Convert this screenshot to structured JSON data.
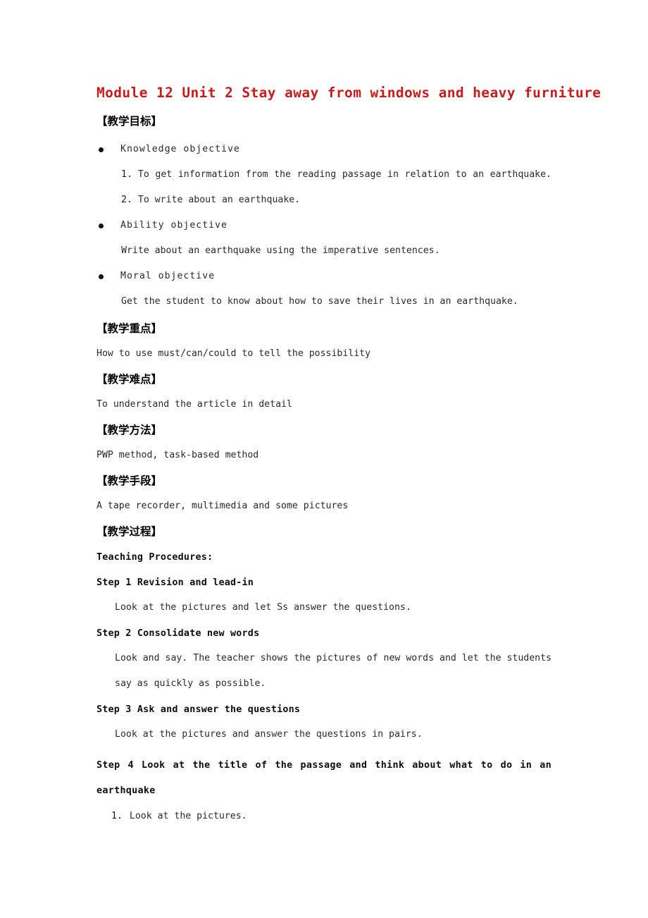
{
  "document": {
    "title": "Module 12 Unit 2 Stay away from windows and heavy furniture",
    "title_color": "#CC1A1A",
    "page_background": "#FFFFFF",
    "text_color": "#2A2A2A"
  },
  "sections": {
    "objectives": {
      "heading": "【教学目标】",
      "groups": [
        {
          "bullet_label": "Knowledge objective",
          "items": [
            {
              "number": "1.",
              "text": "To get information from the reading passage in relation to an earthquake."
            },
            {
              "number": "2.",
              "text": "To write about an earthquake."
            }
          ]
        },
        {
          "bullet_label": "Ability objective",
          "items": [
            {
              "number": "",
              "text": "Write about an earthquake using the imperative sentences."
            }
          ]
        },
        {
          "bullet_label": "Moral objective",
          "items": [
            {
              "number": "",
              "text": "Get the student to know about how to save their lives in an earthquake."
            }
          ]
        }
      ]
    },
    "key_points": {
      "heading": "【教学重点】",
      "body": "How to use must/can/could to tell the possibility"
    },
    "difficult_points": {
      "heading": "【教学难点】",
      "body": "To understand the article in detail"
    },
    "methods": {
      "heading": "【教学方法】",
      "body": "PWP method, task-based method"
    },
    "aids": {
      "heading": "【教学手段】",
      "body": "A tape recorder, multimedia and some pictures"
    },
    "procedures": {
      "heading": "【教学过程】",
      "subtitle": "Teaching Procedures:",
      "steps": [
        {
          "heading": "Step 1 Revision and lead-in",
          "body": "Look at the pictures and let Ss answer the questions.",
          "list": []
        },
        {
          "heading": "Step 2 Consolidate new words",
          "body": "Look and say. The teacher shows the pictures of new words and let the students say as quickly as possible.",
          "list": []
        },
        {
          "heading": "Step 3 Ask and answer the questions",
          "body": "Look at the pictures and answer the questions in pairs.",
          "list": []
        },
        {
          "heading": "Step 4 Look at the title of the passage and think about what to do in an earthquake",
          "body": "",
          "list": [
            {
              "number": "1.",
              "text": "Look at the pictures."
            }
          ]
        }
      ]
    }
  }
}
